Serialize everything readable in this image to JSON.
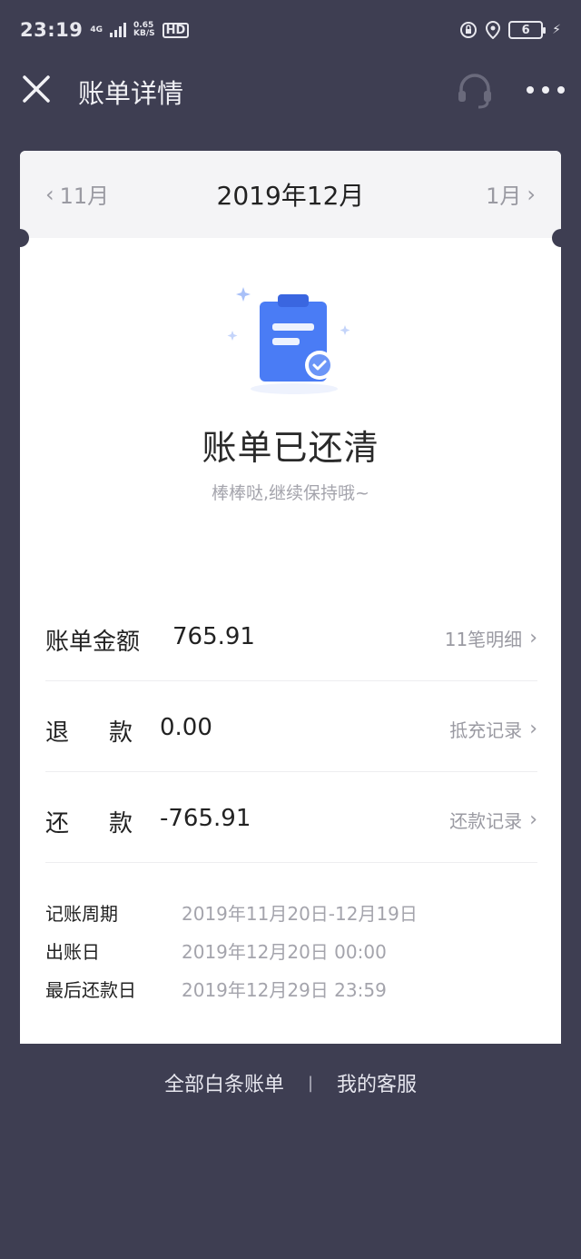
{
  "status_bar": {
    "time": "23:19",
    "net_type": "4G",
    "speed_value": "0.65",
    "speed_unit": "KB/S",
    "hd": "HD",
    "battery": "6"
  },
  "header": {
    "title": "账单详情"
  },
  "month_nav": {
    "prev": "11月",
    "current": "2019年12月",
    "next": "1月"
  },
  "status": {
    "title": "账单已还清",
    "subtitle": "棒棒哒,继续保持哦~"
  },
  "rows": [
    {
      "label": "账单金额",
      "value": "765.91",
      "link": "11笔明细"
    },
    {
      "label_a": "退",
      "label_b": "款",
      "value": "0.00",
      "link": "抵充记录"
    },
    {
      "label_a": "还",
      "label_b": "款",
      "value": "-765.91",
      "link": "还款记录"
    }
  ],
  "info": [
    {
      "label": "记账周期",
      "value": "2019年11月20日-12月19日"
    },
    {
      "label": "出账日",
      "value": "2019年12月20日 00:00"
    },
    {
      "label": "最后还款日",
      "value": "2019年12月29日 23:59"
    }
  ],
  "footer": {
    "all_bills": "全部白条账单",
    "separator": "|",
    "customer_service": "我的客服"
  },
  "colors": {
    "background": "#3e3e52",
    "card": "#ffffff",
    "accent_blue": "#4a7cf5",
    "muted_text": "#a4a4ac"
  }
}
